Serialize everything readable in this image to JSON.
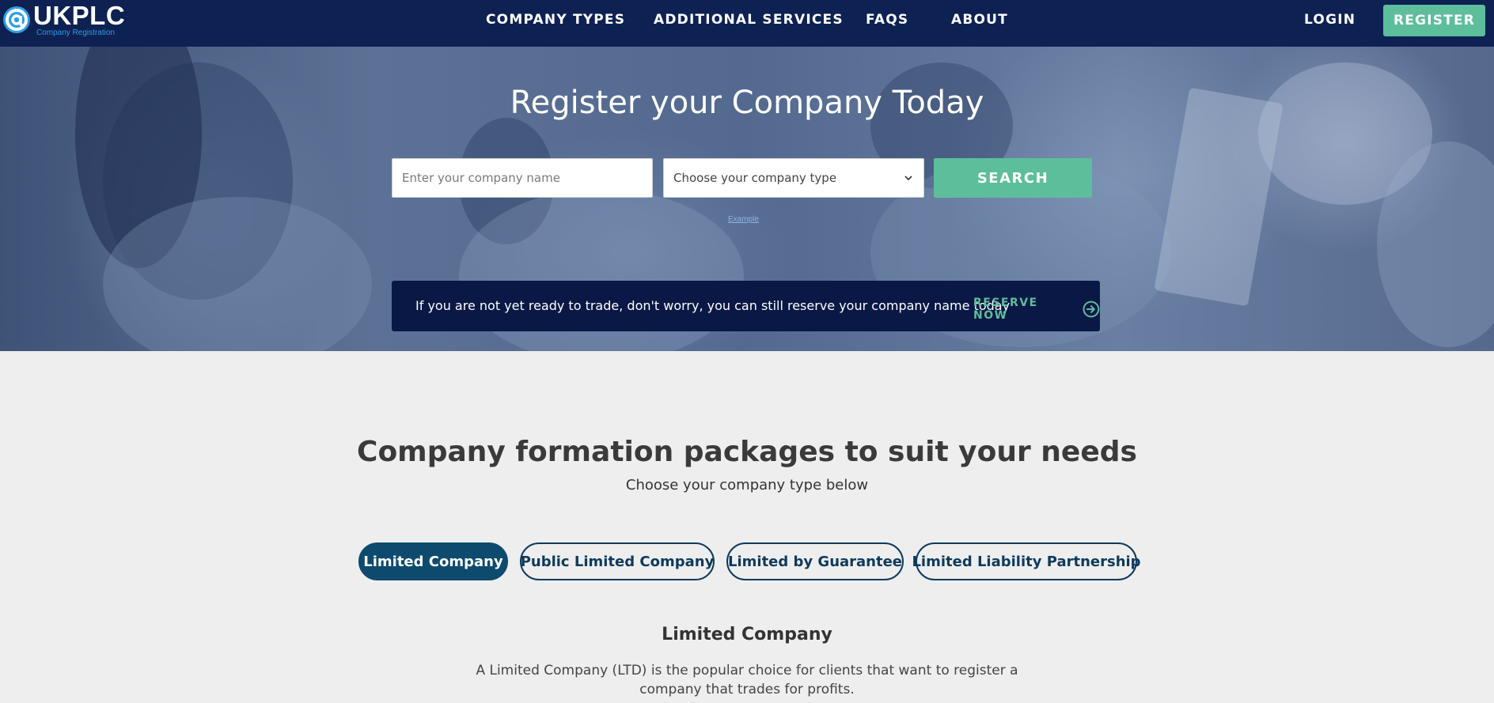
{
  "header": {
    "logo": {
      "main": "UKPLC",
      "sub": "Company Registration"
    },
    "nav": [
      {
        "label": "COMPANY TYPES"
      },
      {
        "label": "ADDITIONAL SERVICES"
      },
      {
        "label": "FAQS"
      },
      {
        "label": "ABOUT"
      }
    ],
    "login_label": "LOGIN",
    "register_label": "REGISTER"
  },
  "hero": {
    "title": "Register your Company Today",
    "name_input": {
      "placeholder": "Enter your company name",
      "value": ""
    },
    "type_select": {
      "selected": "Choose your company type"
    },
    "search_label": "SEARCH",
    "small_link": "Example",
    "reserve": {
      "text": "If you are not yet ready to trade, don't worry, you can still reserve your company name today",
      "link_label": "RESERVE NOW"
    }
  },
  "packages": {
    "title": "Company formation packages to suit your needs",
    "subtitle": "Choose your company type below",
    "tabs": [
      {
        "label": "Limited Company",
        "active": true
      },
      {
        "label": "Public Limited Company",
        "active": false
      },
      {
        "label": "Limited by Guarantee",
        "active": false
      },
      {
        "label": "Limited Liability Partnership",
        "active": false
      }
    ],
    "selected_title": "Limited Company",
    "selected_desc": "A Limited Company (LTD) is the popular choice for clients that want to register a company that trades for profits."
  },
  "colors": {
    "header_bg": "#0d2153",
    "accent_green": "#5dbe9b",
    "tab_navy": "#0d4a6e",
    "reserve_bg": "#0a1845"
  },
  "icons": {
    "logo": "at-sign-icon",
    "select": "chevron-down-icon",
    "reserve": "circle-arrow-right-icon"
  }
}
